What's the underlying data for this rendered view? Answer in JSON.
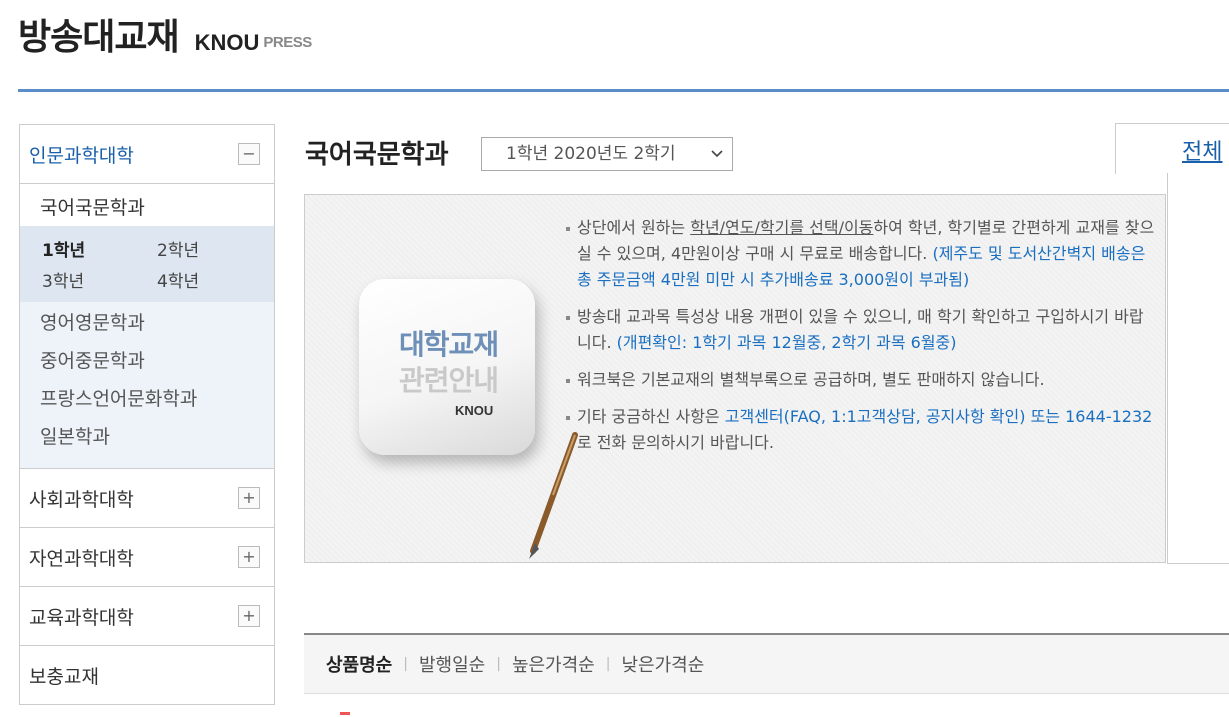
{
  "logo": {
    "main": "방송대교재",
    "knou": "KNOU",
    "press": "PRESS"
  },
  "sidebar": {
    "open_category": {
      "label": "인문과학대학",
      "toggle": "−"
    },
    "active_dept": "국어국문학과",
    "years": [
      "1학년",
      "2학년",
      "3학년",
      "4학년"
    ],
    "other_depts": [
      "영어영문학과",
      "중어중문학과",
      "프랑스언어문화학과",
      "일본학과"
    ],
    "categories": [
      {
        "label": "사회과학대학",
        "toggle": "+"
      },
      {
        "label": "자연과학대학",
        "toggle": "+"
      },
      {
        "label": "교육과학대학",
        "toggle": "+"
      }
    ],
    "supplement": "보충교재"
  },
  "main": {
    "title": "국어국문학과",
    "select_value": "1학년 2020년도 2학기",
    "all_tab": "전체"
  },
  "info": {
    "badge_line1": "대학교재",
    "badge_line2": "관련안내",
    "badge_knou": "KNOU",
    "note1_a": "상단에서 원하는 ",
    "note1_u": "학년/연도/학기를 선택/이동",
    "note1_b": "하여 학년, 학기별로 간편하게 교재를 찾으실 수 있으며, 4만원이상 구매 시 무료로 배송합니다.",
    "note1_blue": "(제주도 및 도서산간벽지 배송은 총 주문금액 4만원 미만 시 추가배송료 3,000원이 부과됨)",
    "note2_a": "방송대 교과목 특성상 내용 개편이 있을 수 있으니, 매 학기 확인하고 구입하시기 바랍니다. ",
    "note2_blue": "(개편확인: 1학기 과목 12월중, 2학기 과목 6월중)",
    "note3": "워크북은 기본교재의 별책부록으로 공급하며, 별도 판매하지 않습니다.",
    "note4_a": "기타 궁금하신 사항은 ",
    "note4_blue": "고객센터(FAQ, 1:1고객상담, 공지사항 확인) 또는 1644-1232",
    "note4_b": "로 전화 문의하시기 바랍니다."
  },
  "sort": {
    "options": [
      "상품명순",
      "발행일순",
      "높은가격순",
      "낮은가격순"
    ],
    "separator": "|",
    "active_index": 0
  }
}
